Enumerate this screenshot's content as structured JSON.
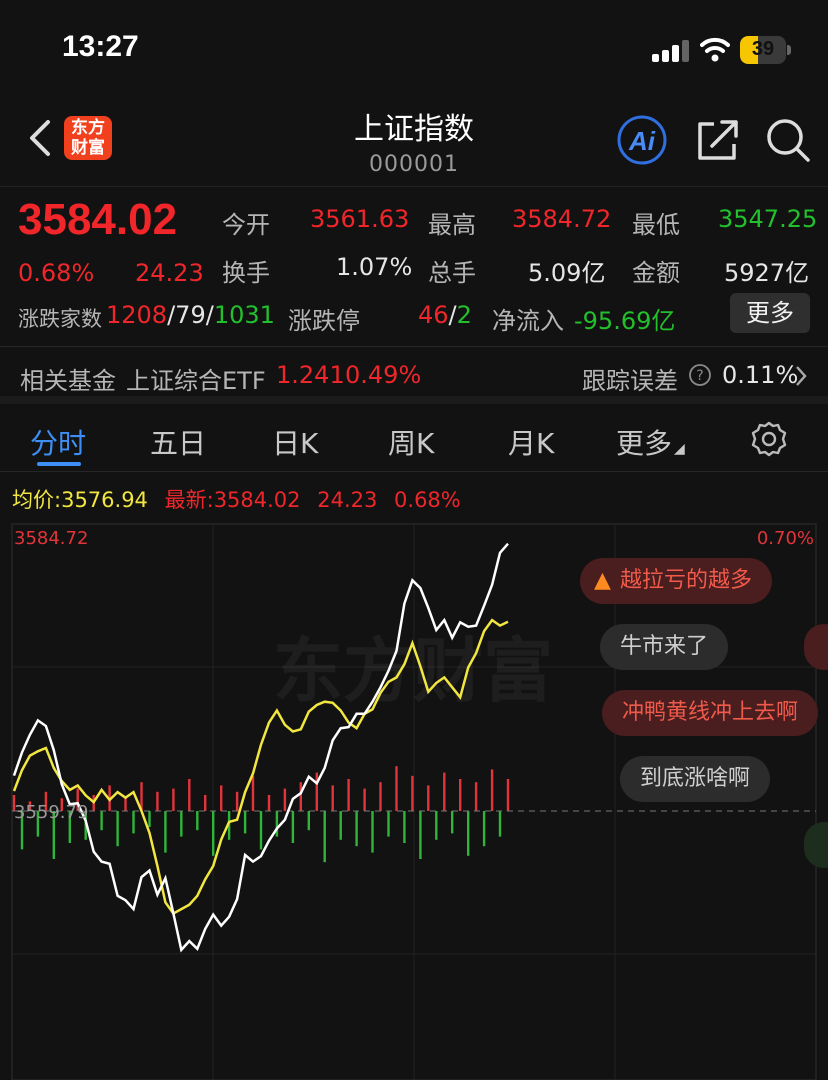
{
  "status_bar": {
    "time": "13:27",
    "battery": "39",
    "battery_level": 0.39
  },
  "header": {
    "logo_line1": "东方",
    "logo_line2": "财富",
    "title": "上证指数",
    "code": "000001",
    "icons": [
      "back-icon",
      "ai-icon",
      "share-icon",
      "search-icon"
    ]
  },
  "quote": {
    "price": "3584.02",
    "change_pct": "0.68%",
    "change": "24.23",
    "open_label": "今开",
    "open": "3561.63",
    "high_label": "最高",
    "high": "3584.72",
    "low_label": "最低",
    "low": "3547.25",
    "turnover_label": "换手",
    "turnover": "1.07%",
    "volume_label": "总手",
    "volume": "5.09亿",
    "amount_label": "金额",
    "amount": "5927亿",
    "breadth_label": "涨跌家数",
    "up_count": "1208",
    "flat_count": "79",
    "down_count": "1031",
    "limit_label": "涨跌停",
    "limit_up": "46",
    "limit_down": "2",
    "netflow_label": "净流入",
    "netflow": "-95.69亿",
    "more_label": "更多"
  },
  "fund": {
    "label": "相关基金",
    "name": "上证综合ETF",
    "price": "1.241",
    "pct": "0.49%",
    "tracking_label": "跟踪误差",
    "tracking": "0.11%"
  },
  "tabs": [
    "分时",
    "五日",
    "日K",
    "周K",
    "月K",
    "更多"
  ],
  "legend": {
    "avg_label": "均价:",
    "avg": "3576.94",
    "latest_label": "最新:",
    "latest": "3584.02",
    "change": "24.23",
    "pct": "0.68%"
  },
  "chart_data": {
    "type": "line",
    "top_price_label": "3584.72",
    "top_pct_label": "0.70%",
    "base_price_label": "3559.79",
    "y_range": [
      3534.86,
      3584.72
    ],
    "watermark": "东方财富",
    "colors": {
      "price": "#ffffff",
      "avg": "#f2e640",
      "up": "#e2343a",
      "down": "#2fb53a"
    },
    "series": [
      {
        "values": [
          3563.0,
          3565.1,
          3566.7,
          3568.0,
          3567.5,
          3565.3,
          3562.2,
          3560.4,
          3560.5,
          3558.9,
          3556.1,
          3555.2,
          3555.0,
          3552.1,
          3551.7,
          3550.9,
          3553.8,
          3554.4,
          3552.2,
          3553.7,
          3550.5,
          3547.2,
          3548.0,
          3547.3,
          3549.1,
          3550.4,
          3549.4,
          3550.2,
          3551.8,
          3555.8,
          3555.2,
          3555.7,
          3557.1,
          3558.2,
          3559.0,
          3560.9,
          3561.4,
          3562.9,
          3562.3,
          3563.7,
          3566.2,
          3567.3,
          3567.4,
          3568.6,
          3568.6,
          3569.7,
          3571.0,
          3572.5,
          3574.3,
          3578.6,
          3580.7,
          3580.0,
          3578.2,
          3576.2,
          3577.1,
          3575.5,
          3576.9,
          3576.5,
          3576.6,
          3578.4,
          3580.3,
          3583.2,
          3584.02
        ]
      },
      {
        "values": [
          3561.6,
          3563.5,
          3564.8,
          3565.2,
          3565.5,
          3563.7,
          3562.5,
          3561.7,
          3562.1,
          3561.2,
          3560.6,
          3561.7,
          3560.8,
          3561.5,
          3561.0,
          3561.5,
          3559.8,
          3557.8,
          3554.8,
          3551.5,
          3550.5,
          3550.9,
          3551.3,
          3552.1,
          3553.6,
          3554.8,
          3557.2,
          3558.8,
          3559.0,
          3561.5,
          3563.2,
          3565.8,
          3567.8,
          3568.9,
          3567.6,
          3567.0,
          3567.2,
          3568.8,
          3569.4,
          3569.7,
          3569.6,
          3568.9,
          3567.8,
          3567.3,
          3568.6,
          3569.0,
          3570.5,
          3571.5,
          3571.9,
          3573.1,
          3575.0,
          3572.9,
          3570.6,
          3571.4,
          3571.9,
          3571.0,
          3570.1,
          3572.8,
          3574.1,
          3576.1,
          3577.1,
          3576.6,
          3576.94
        ]
      }
    ],
    "volume_bars": [
      5,
      -12,
      3,
      -8,
      6,
      -15,
      4,
      -10,
      7,
      -9,
      5,
      -6,
      8,
      -11,
      4,
      -7,
      9,
      -5,
      6,
      -13,
      7,
      -8,
      10,
      -6,
      5,
      -14,
      8,
      -9,
      6,
      -7,
      11,
      -12,
      5,
      -8,
      7,
      -10,
      9,
      -6,
      12,
      -16,
      8,
      -9,
      10,
      -11,
      7,
      -13,
      9,
      -8,
      14,
      -10,
      11,
      -15,
      8,
      -9,
      12,
      -7,
      10,
      -14,
      9,
      -11,
      13,
      -8,
      10
    ]
  },
  "barrage": [
    {
      "text": "越拉亏的越多",
      "style": "red",
      "has_icon": true
    },
    {
      "text": "牛市来了",
      "style": "grey"
    },
    {
      "text": "冲鸭黄线冲上去啊",
      "style": "red"
    },
    {
      "text": "到底涨啥啊",
      "style": "grey"
    }
  ]
}
